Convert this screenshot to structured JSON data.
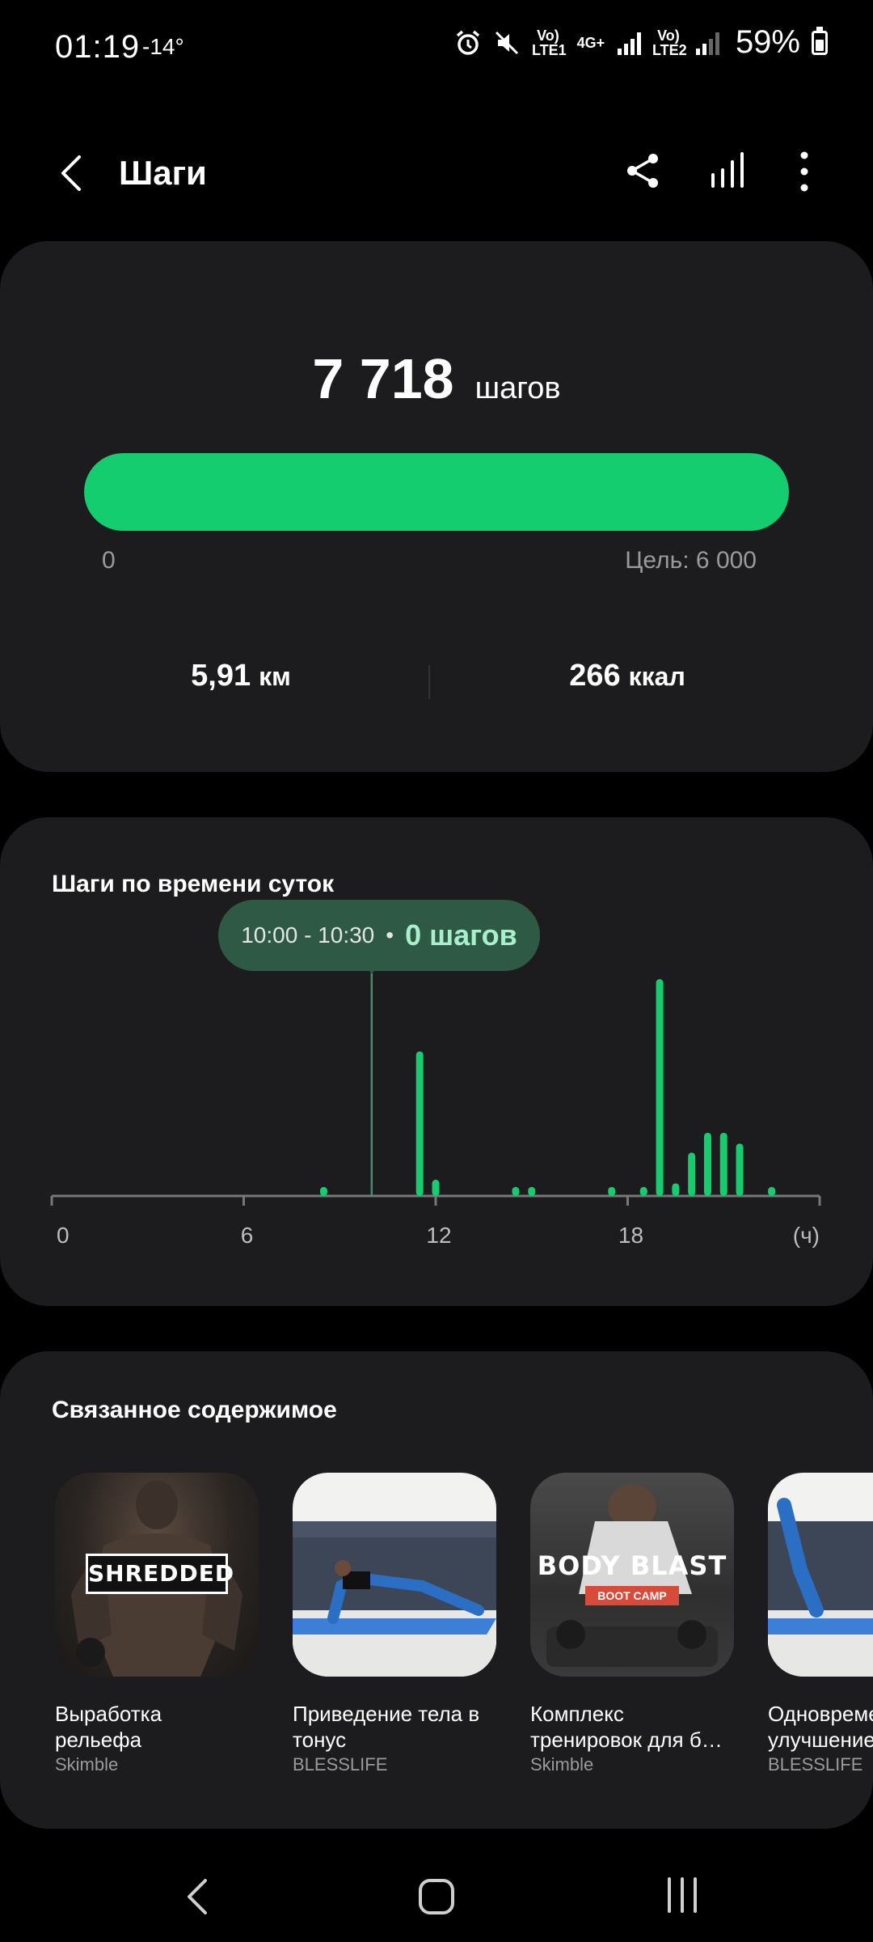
{
  "status_bar": {
    "time": "01:19",
    "temperature": "-14°",
    "battery": "59%",
    "sim1_label": "Vo) LTE1",
    "sim2_label": "Vo) LTE2",
    "net_type": "4G+",
    "icons": [
      "alarm-icon",
      "mute-icon",
      "signal-icon",
      "battery-icon"
    ]
  },
  "app_bar": {
    "title": "Шаги",
    "actions": [
      "back-icon",
      "share-icon",
      "chart-icon",
      "more-icon"
    ]
  },
  "summary": {
    "steps_value": "7 718",
    "steps_unit": "шагов",
    "progress_start": "0",
    "goal_label": "Цель: 6 000",
    "progress_fraction": 1.0,
    "distance_value": "5,91",
    "distance_unit": "км",
    "calories_value": "266",
    "calories_unit": "ккал",
    "accent_color": "#13cd6f"
  },
  "chart_section": {
    "title": "Шаги по времени суток",
    "tooltip_range": "10:00 - 10:30",
    "tooltip_dot": "•",
    "tooltip_value": "0 шагов"
  },
  "chart_data": {
    "type": "bar",
    "x_ticks": [
      "0",
      "6",
      "12",
      "18"
    ],
    "x_unit_label": "(ч)",
    "xlim": [
      0,
      24
    ],
    "ylim": [
      0,
      400
    ],
    "selected_interval_start": 10.0,
    "x": [
      8.5,
      11.5,
      12.0,
      14.5,
      15.0,
      17.5,
      18.5,
      19.0,
      19.5,
      20.0,
      20.5,
      21.0,
      21.5,
      22.5
    ],
    "values": [
      25,
      400,
      45,
      25,
      25,
      25,
      25,
      600,
      35,
      120,
      175,
      175,
      145,
      25
    ],
    "color": "#13cd6f"
  },
  "related": {
    "title": "Связанное содержимое",
    "items": [
      {
        "name": "Выработка рельефа",
        "author": "Skimble",
        "thumb_text": "SHREDDED"
      },
      {
        "name": "Приведение тела в тонус",
        "author": "BLESSLIFE",
        "thumb_text": ""
      },
      {
        "name": "Комплекс тренировок для б…",
        "author": "Skimble",
        "thumb_text": "BODY BLAST",
        "thumb_subtext": "BOOT CAMP"
      },
      {
        "name": "Одновременное улучшение",
        "author": "BLESSLIFE",
        "thumb_text": ""
      }
    ]
  },
  "nav_bar": {
    "buttons": [
      "nav-back-icon",
      "nav-home-icon",
      "nav-recent-icon"
    ]
  }
}
